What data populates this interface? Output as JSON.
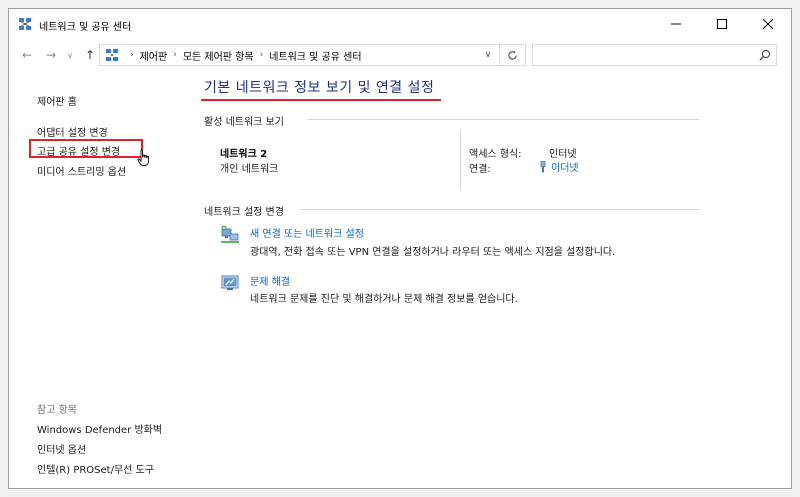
{
  "window": {
    "title": "네트워크 및 공유 센터"
  },
  "address": {
    "crumbs": [
      "제어판",
      "모든 제어판 항목",
      "네트워크 및 공유 센터"
    ],
    "search_placeholder": ""
  },
  "sidebar": {
    "home": "제어판 홈",
    "links": [
      "어댑터 설정 변경",
      "고급 공유 설정 변경",
      "미디어 스트리밍 옵션"
    ],
    "see_also_caption": "참고 항목",
    "see_also": [
      "Windows Defender 방화벽",
      "인터넷 옵션",
      "인텔(R) PROSet/무선 도구"
    ]
  },
  "main": {
    "title": "기본 네트워크 정보 보기 및 연결 설정",
    "active_section": "활성 네트워크 보기",
    "network": {
      "name": "네트워크 2",
      "type": "개인 네트워크",
      "access_label": "액세스 형식:",
      "access_value": "인터넷",
      "conn_label": "연결:",
      "conn_value": "이더넷"
    },
    "change_section": "네트워크 설정 변경",
    "tasks": [
      {
        "link": "새 연결 또는 네트워크 설정",
        "desc": "광대역, 전화 접속 또는 VPN 연결을 설정하거나 라우터 또는 액세스 지점을 설정합니다."
      },
      {
        "link": "문제 해결",
        "desc": "네트워크 문제를 진단 및 해결하거나 문제 해결 정보를 얻습니다."
      }
    ]
  },
  "colors": {
    "link": "#0066cc",
    "title": "#1e3287",
    "highlight": "#e0202a"
  }
}
